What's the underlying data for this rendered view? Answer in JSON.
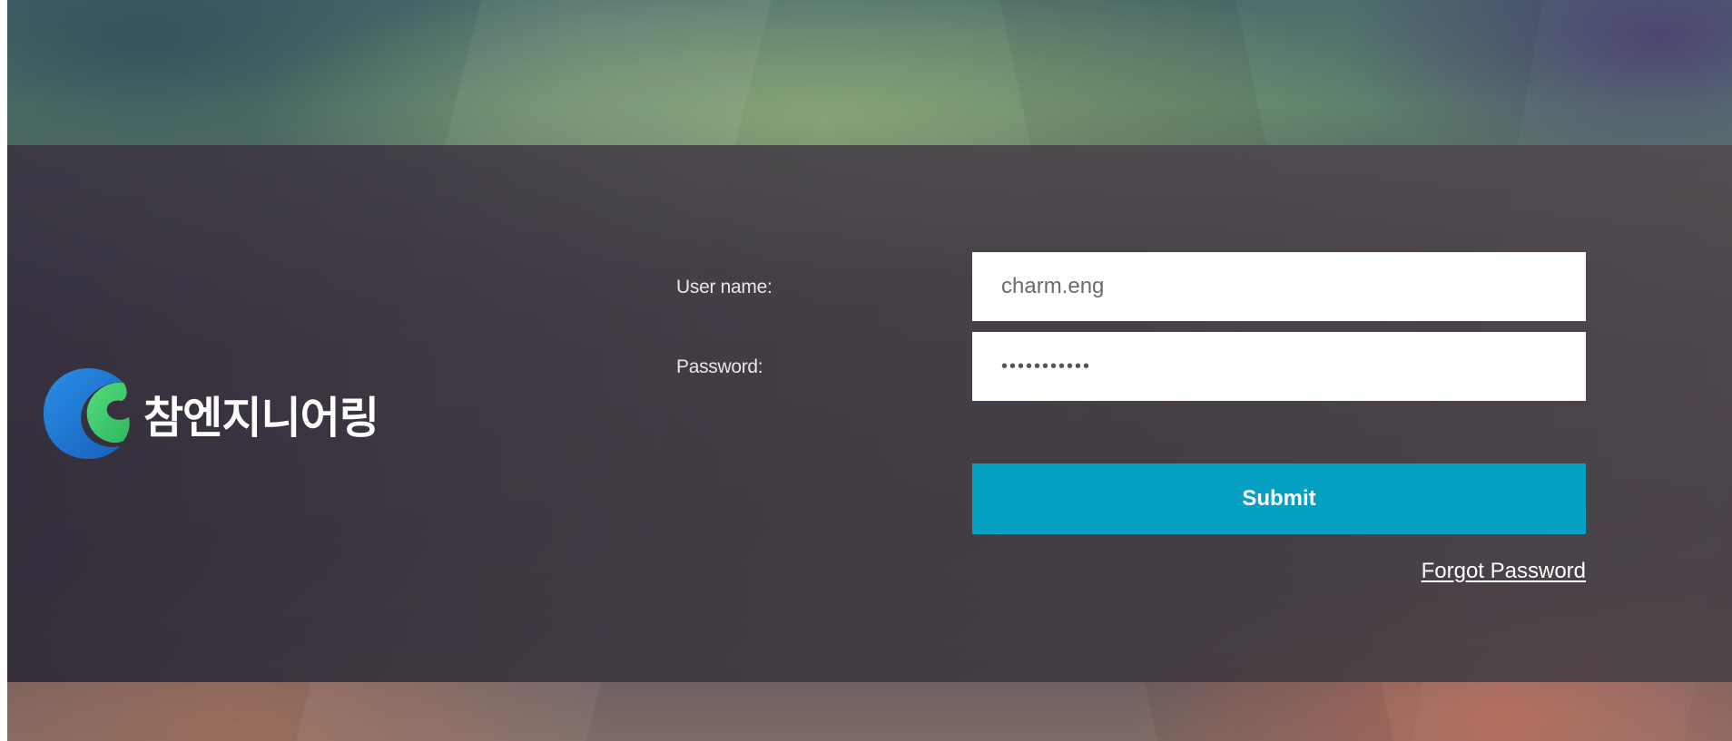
{
  "brand": {
    "name": "참엔지니어링",
    "logo_icon": "charm-c-logo-icon",
    "colors": {
      "logo_blue": "#1c78d4",
      "logo_green": "#3fcf6e"
    }
  },
  "login_form": {
    "username_label": "User name:",
    "username_value": "charm.eng",
    "password_label": "Password:",
    "password_value": "•••••••••••",
    "submit_label": "Submit",
    "forgot_password_label": "Forgot Password"
  },
  "theme": {
    "button_color": "#05a0c2",
    "band_color": "#453f4b",
    "text_color": "#ffffff"
  }
}
